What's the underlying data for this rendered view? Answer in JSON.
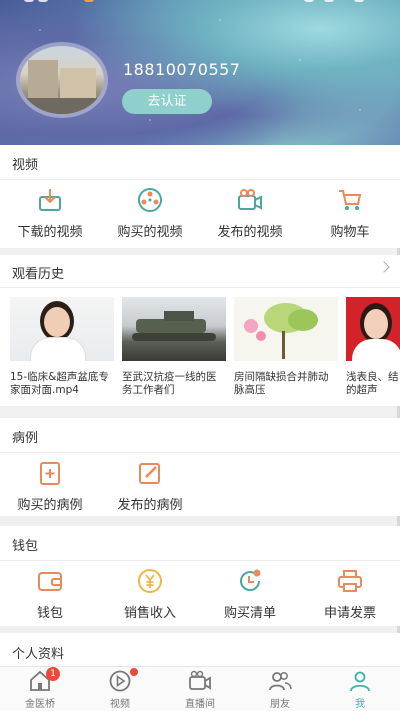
{
  "profile": {
    "phone": "18810070557",
    "verify_label": "去认证"
  },
  "video_section": {
    "title": "视频",
    "items": [
      {
        "label": "下载的视频",
        "icon": "download-box-icon"
      },
      {
        "label": "购买的视频",
        "icon": "film-reel-icon"
      },
      {
        "label": "发布的视频",
        "icon": "video-camera-icon"
      },
      {
        "label": "购物车",
        "icon": "shopping-cart-icon"
      }
    ]
  },
  "history_section": {
    "title": "观看历史",
    "items": [
      {
        "caption": "15-临床&超声盆底专家面对面.mp4"
      },
      {
        "caption": "至武汉抗疫一线的医务工作者们"
      },
      {
        "caption": "房间隔缺损合并肺动脉高压"
      },
      {
        "caption": "浅表良、结的超声"
      }
    ]
  },
  "case_section": {
    "title": "病例",
    "items": [
      {
        "label": "购买的病例",
        "icon": "medical-file-icon"
      },
      {
        "label": "发布的病例",
        "icon": "edit-icon"
      }
    ]
  },
  "wallet_section": {
    "title": "钱包",
    "items": [
      {
        "label": "钱包",
        "icon": "wallet-icon"
      },
      {
        "label": "销售收入",
        "icon": "yuan-coin-icon"
      },
      {
        "label": "购买清单",
        "icon": "clock-list-icon"
      },
      {
        "label": "申请发票",
        "icon": "printer-icon"
      }
    ]
  },
  "profile_section": {
    "title": "个人资料"
  },
  "tabbar": {
    "tabs": [
      {
        "label": "金医桥",
        "icon": "home-icon",
        "badge": "1"
      },
      {
        "label": "视频",
        "icon": "play-circle-icon"
      },
      {
        "label": "直播间",
        "icon": "camera-icon"
      },
      {
        "label": "朋友",
        "icon": "friends-icon"
      },
      {
        "label": "我",
        "icon": "person-icon",
        "active": true
      }
    ]
  },
  "colors": {
    "accent": "#3bb4a8",
    "icon_orange": "#e88a5a",
    "icon_teal": "#4aa6a0",
    "badge_red": "#e84b3a"
  }
}
